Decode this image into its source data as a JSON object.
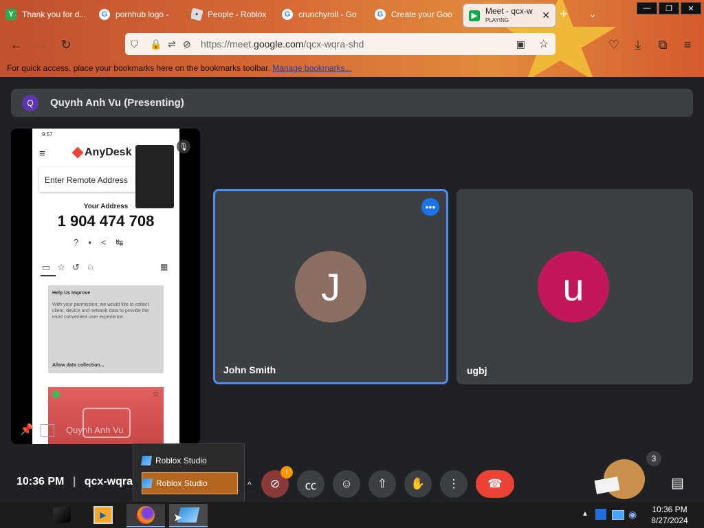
{
  "browser": {
    "tabs": [
      {
        "label": "Thank you for d...",
        "icon": "envelope-icon",
        "color": "#2eaa4f"
      },
      {
        "label": "pornhub logo -",
        "icon": "google-icon",
        "color": "#ffffff"
      },
      {
        "label": "People - Roblox",
        "icon": "roblox-icon",
        "color": "#dddddd"
      },
      {
        "label": "crunchyroll - Go",
        "icon": "google-icon",
        "color": "#ffffff"
      },
      {
        "label": "Create your Goo",
        "icon": "google-icon",
        "color": "#ffffff"
      }
    ],
    "active_tab": {
      "label": "Meet - qcx-w",
      "sub": "PLAYING"
    },
    "new_tab": "+",
    "url_prefix": "https://meet.",
    "url_domain": "google.com",
    "url_path": "/qcx-wqra-shd",
    "bookmarks_text": "For quick access, place your bookmarks here on the bookmarks toolbar.",
    "bookmarks_link": "Manage bookmarks..."
  },
  "meet": {
    "presenter_initial": "Q",
    "presenter_label": "Quynh Anh Vu (Presenting)",
    "screen_share_name": "Quynh Anh Vu",
    "phone": {
      "status_time": "9:57",
      "app_name": "AnyDesk",
      "remote_placeholder": "Enter Remote Address",
      "your_address_label": "Your Address",
      "address": "1 904 474 708",
      "card_title": "Help Us Improve",
      "card_body": "With your permission, we would like to collect client, device and network data to provide the most convenient user experience.",
      "card_action": "Allow data collection..."
    },
    "participants": [
      {
        "name": "John Smith",
        "initial": "J",
        "color": "#8d6e63"
      },
      {
        "name": "ugbj",
        "initial": "u",
        "color": "#c2185b"
      }
    ],
    "time": "10:36 PM",
    "meeting_code": "qcx-wqra-",
    "participant_count": "3",
    "colors": {
      "end_call": "#ea4335",
      "highlight": "#4285f4"
    }
  },
  "taskbar": {
    "popup_items": [
      "Roblox Studio",
      "Roblox Studio"
    ],
    "clock_time": "10:36 PM",
    "clock_date": "8/27/2024"
  }
}
